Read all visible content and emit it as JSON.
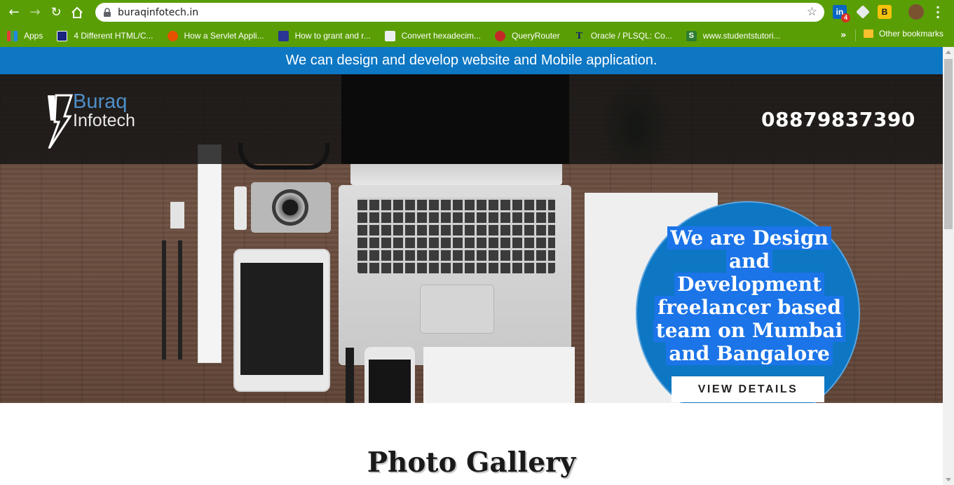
{
  "browser": {
    "url": "buraqinfotech.in",
    "extension_badge": "4",
    "bookmarks": [
      {
        "label": "Apps",
        "icon": "apps-grid-icon"
      },
      {
        "label": "4 Different HTML/C...",
        "icon": "monitor-icon"
      },
      {
        "label": "How a Servlet Appli...",
        "icon": "shield-icon"
      },
      {
        "label": "How to grant and r...",
        "icon": "play-icon"
      },
      {
        "label": "Convert hexadecim...",
        "icon": "puzzle-icon"
      },
      {
        "label": "QueryRouter",
        "icon": "huawei-icon"
      },
      {
        "label": "Oracle / PLSQL: Co...",
        "icon": "t-icon"
      },
      {
        "label": "www.studentstutori...",
        "icon": "s-icon"
      }
    ],
    "other_bookmarks": "Other bookmarks"
  },
  "site": {
    "banner": "We can design and develop website and Mobile application.",
    "logo_line1": "Buraq",
    "logo_line2": "Infotech",
    "phone": "08879837390",
    "hero_lines": [
      "We are Design",
      "and",
      "Development",
      "freelancer based",
      "team on Mumbai",
      "and Bangalore"
    ],
    "cta": "VIEW DETAILS",
    "section_title": "Photo Gallery"
  },
  "colors": {
    "chrome_green": "#5a9e05",
    "brand_blue": "#0d77c4",
    "logo_blue": "#4e8fc8"
  }
}
